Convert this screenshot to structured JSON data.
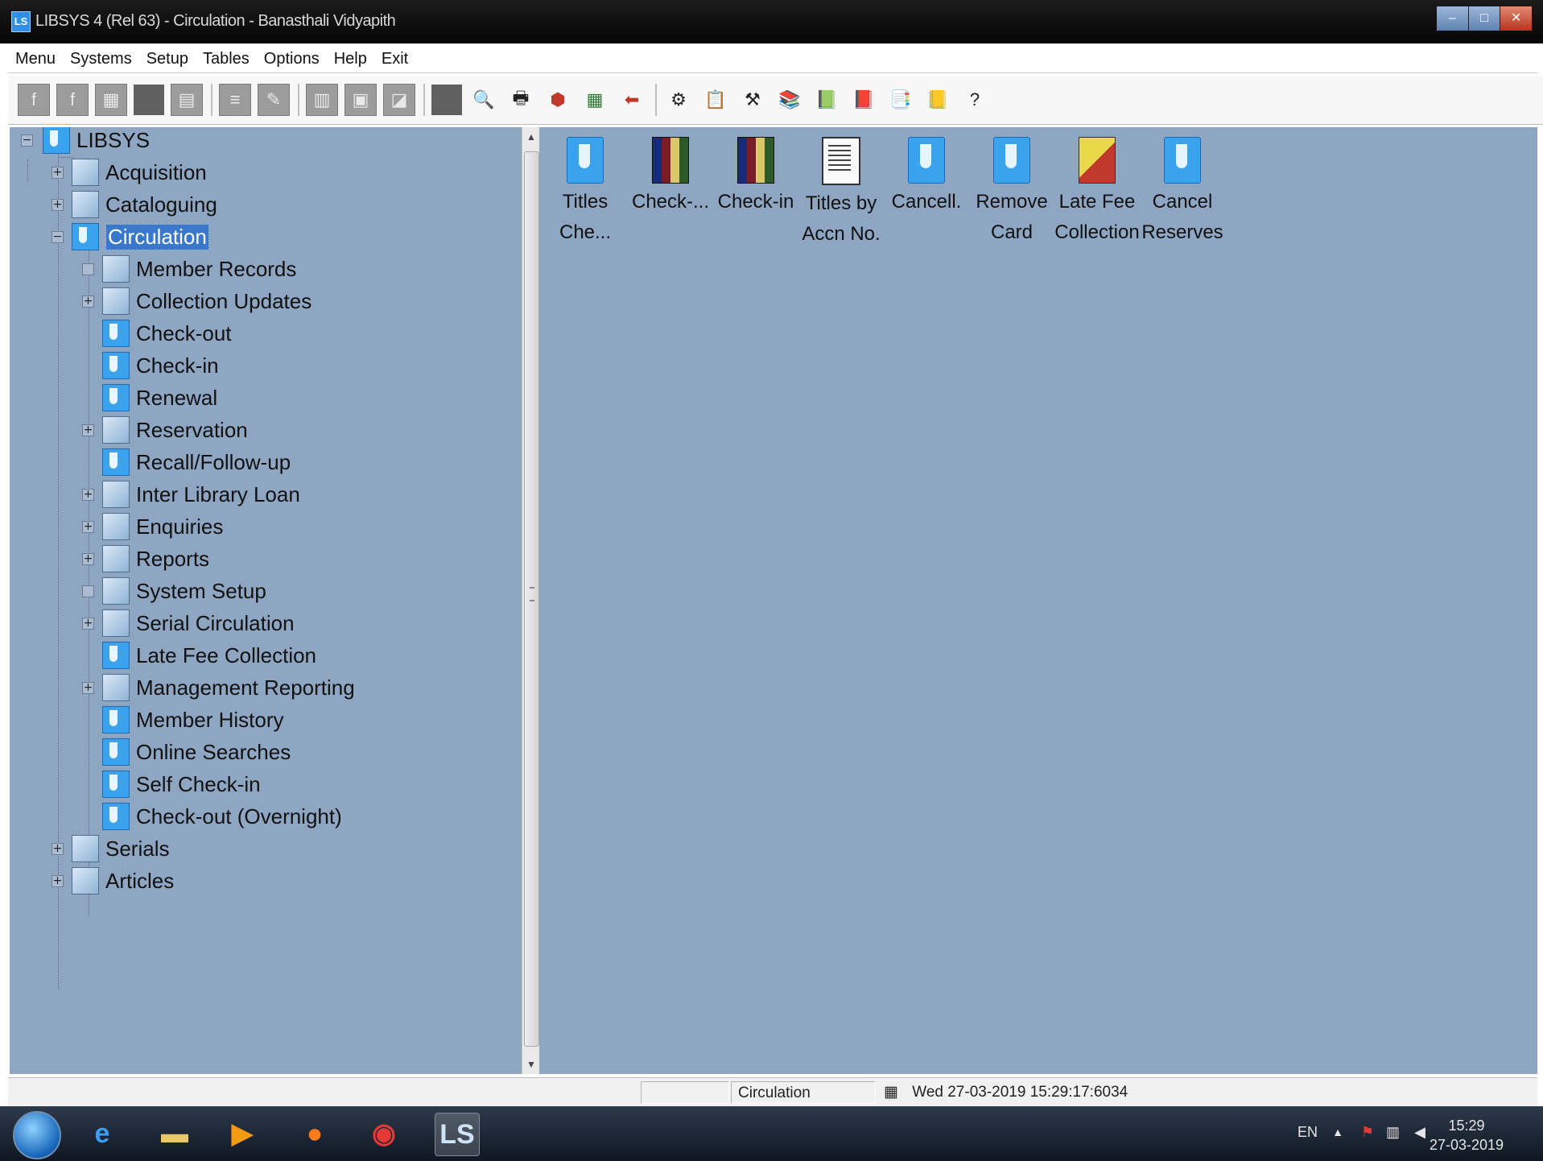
{
  "window": {
    "title": "LIBSYS 4 (Rel 63) - Circulation - Banasthali Vidyapith",
    "app_icon": "LS"
  },
  "menu": [
    "Menu",
    "Systems",
    "Setup",
    "Tables",
    "Options",
    "Help",
    "Exit"
  ],
  "toolbar": {
    "icons": [
      "f-icon",
      "f-icon",
      "calc-icon",
      "blank-icon",
      "calendar-icon",
      "list-icon",
      "edit-icon",
      "record-icon",
      "form-icon",
      "check-icon",
      "blank-icon",
      "search-icon",
      "print-icon",
      "stop-icon",
      "spreadsheet-icon",
      "back-arrow-icon",
      "tool-icon",
      "tool-icon",
      "tool-icon",
      "tool-icon",
      "tool-icon",
      "tool-icon",
      "tool-icon",
      "tool-icon",
      "help-icon"
    ]
  },
  "tree": {
    "root": "LIBSYS",
    "items": [
      {
        "label": "Acquisition"
      },
      {
        "label": "Cataloguing"
      },
      {
        "label": "Circulation",
        "selected": true
      },
      {
        "label": "Member Records"
      },
      {
        "label": "Collection Updates"
      },
      {
        "label": "Check-out"
      },
      {
        "label": "Check-in"
      },
      {
        "label": "Renewal"
      },
      {
        "label": "Reservation"
      },
      {
        "label": "Recall/Follow-up"
      },
      {
        "label": "Inter Library Loan"
      },
      {
        "label": "Enquiries"
      },
      {
        "label": "Reports"
      },
      {
        "label": "System Setup"
      },
      {
        "label": "Serial Circulation"
      },
      {
        "label": "Late Fee Collection"
      },
      {
        "label": "Management Reporting"
      },
      {
        "label": "Member History"
      },
      {
        "label": "Online Searches"
      },
      {
        "label": "Self Check-in"
      },
      {
        "label": "Check-out (Overnight)"
      },
      {
        "label": "Serials"
      },
      {
        "label": "Articles"
      }
    ]
  },
  "main": {
    "icons": [
      {
        "line1": "Titles",
        "line2": "Che..."
      },
      {
        "line1": "Check-...",
        "line2": ""
      },
      {
        "line1": "Check-in",
        "line2": ""
      },
      {
        "line1": "Titles by",
        "line2": "Accn No."
      },
      {
        "line1": "Cancell.",
        "line2": ""
      },
      {
        "line1": "Remove",
        "line2": "Card"
      },
      {
        "line1": "Late Fee",
        "line2": "Collection"
      },
      {
        "line1": "Cancel",
        "line2": "Reserves"
      }
    ]
  },
  "status": {
    "module": "Circulation",
    "datetime": "Wed 27-03-2019 15:29:17:6034"
  },
  "taskbar": {
    "lang": "EN",
    "time": "15:29",
    "date": "27-03-2019",
    "apps": [
      "ie-icon",
      "folder-icon",
      "media-icon",
      "firefox-icon",
      "chrome-icon",
      "libsys-icon"
    ]
  }
}
